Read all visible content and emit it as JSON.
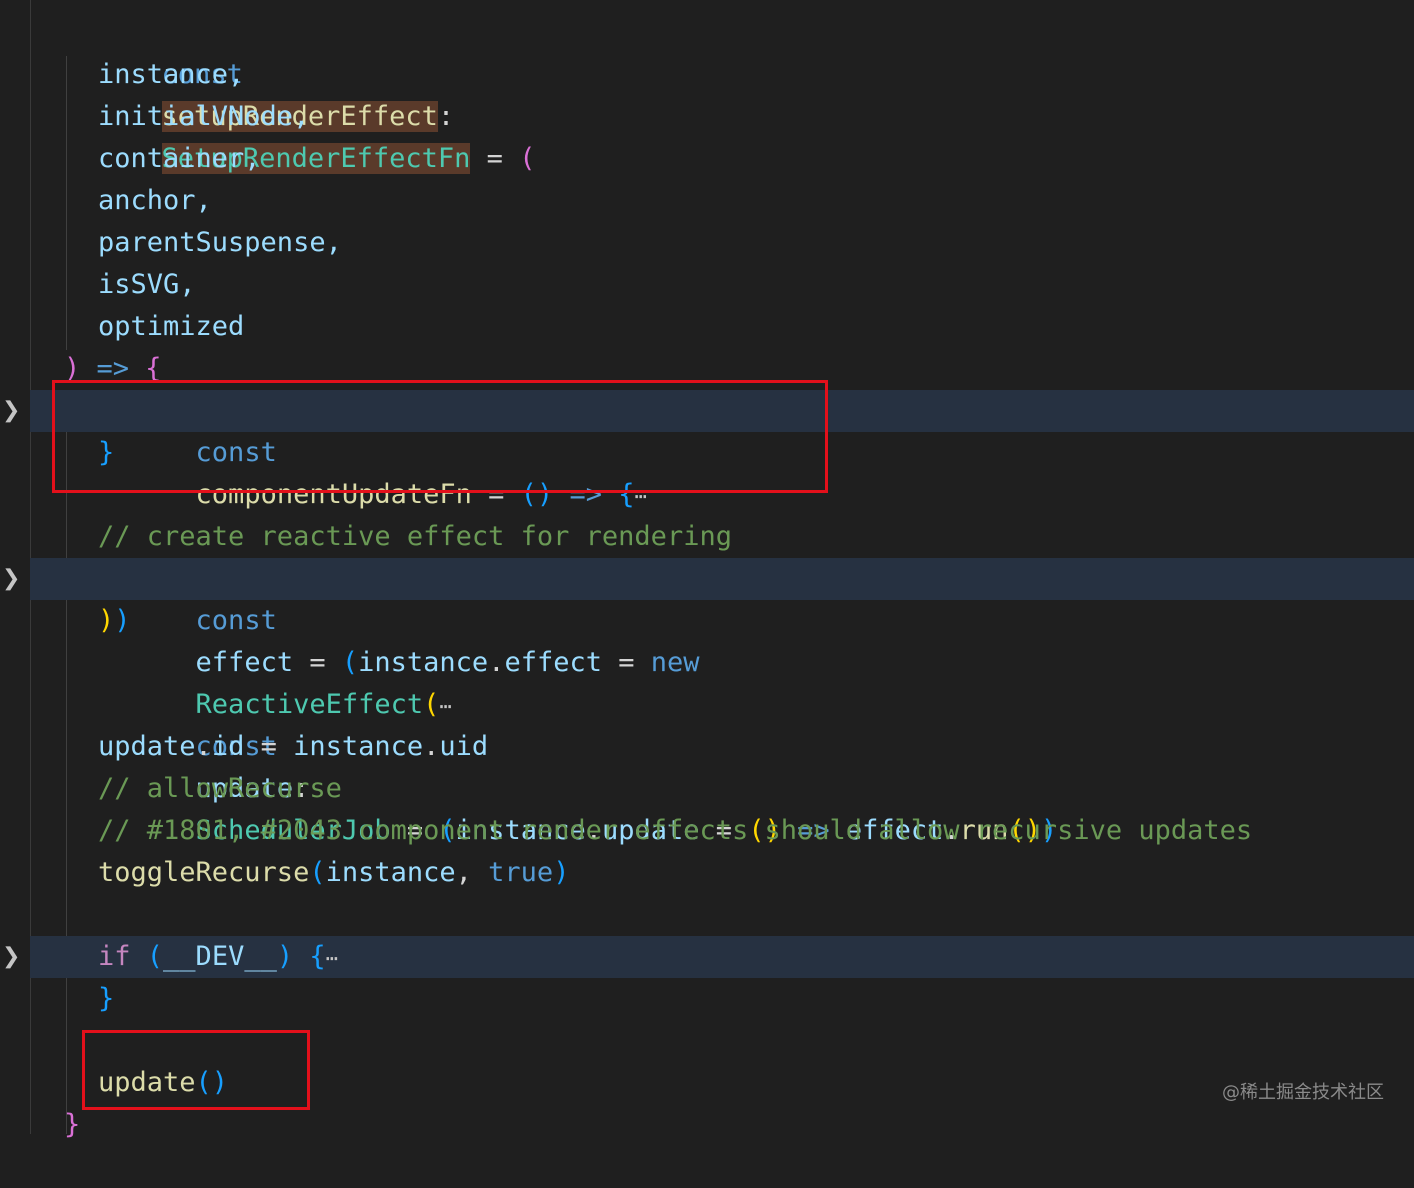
{
  "code": {
    "header": {
      "kw": "const",
      "name": "setupRenderEffect",
      "colon": ":",
      "type": "SetupRenderEffectFn",
      "assign": " = ",
      "paren": "("
    },
    "params": [
      "instance,",
      "initialVNode,",
      "container,",
      "anchor,",
      "parentSuspense,",
      "isSVG,",
      "optimized"
    ],
    "arrow_line": {
      "paren": ")",
      "arrow": " => ",
      "brace": "{"
    },
    "component_update": {
      "kw": "const",
      "name": "componentUpdateFn",
      "assign": " = ",
      "parens": "()",
      "arrow": " => ",
      "brace": "{",
      "ellipsis": "⋯",
      "close": "}"
    },
    "comment_reactive": "// create reactive effect for rendering",
    "effect_line": {
      "kw": "const",
      "name": "effect",
      "assign": " = ",
      "paren": "(",
      "obj": "instance",
      "dot": ".",
      "prop": "effect",
      "assign2": " = ",
      "new": "new",
      "cls": "ReactiveEffect",
      "paren2": "(",
      "ellipsis": "⋯"
    },
    "effect_close": {
      "p1": ")",
      "p2": ")"
    },
    "update_line": {
      "kw": "const",
      "name": "update",
      "colon": ":",
      "type": "SchedulerJob",
      "assign": " = ",
      "paren": "(",
      "obj": "instance",
      "dot": ".",
      "prop": "update",
      "assign2": " = ",
      "parens": "()",
      "arrow": " => ",
      "effect": "effect",
      "dot2": ".",
      "run": "run",
      "run_parens": "()",
      "close": ")"
    },
    "uid_line": {
      "upd": "update",
      "dot": ".",
      "id": "id",
      "assign": " = ",
      "obj": "instance",
      "dot2": ".",
      "uid": "uid"
    },
    "comment_allow": "// allowRecurse",
    "comment_issues": "// #1801, #2043 component render effects should allow recursive updates",
    "toggle_line": {
      "fn": "toggleRecurse",
      "paren": "(",
      "arg1": "instance",
      "comma": ", ",
      "arg2": "true",
      "close": ")"
    },
    "dev_line": {
      "kw": "if",
      "space": " ",
      "paren": "(",
      "flag": "__DEV__",
      "close": ")",
      "brace": " {",
      "ellipsis": "⋯",
      "close_brace": "}"
    },
    "update_call": {
      "fn": "update",
      "parens": "()"
    },
    "final_brace": "}"
  },
  "fold_icon": "chevron-right-icon",
  "highlight_colors": {
    "red_box": "#e3101b",
    "fold_bg": "#263141"
  },
  "watermark": "@稀土掘金技术社区"
}
